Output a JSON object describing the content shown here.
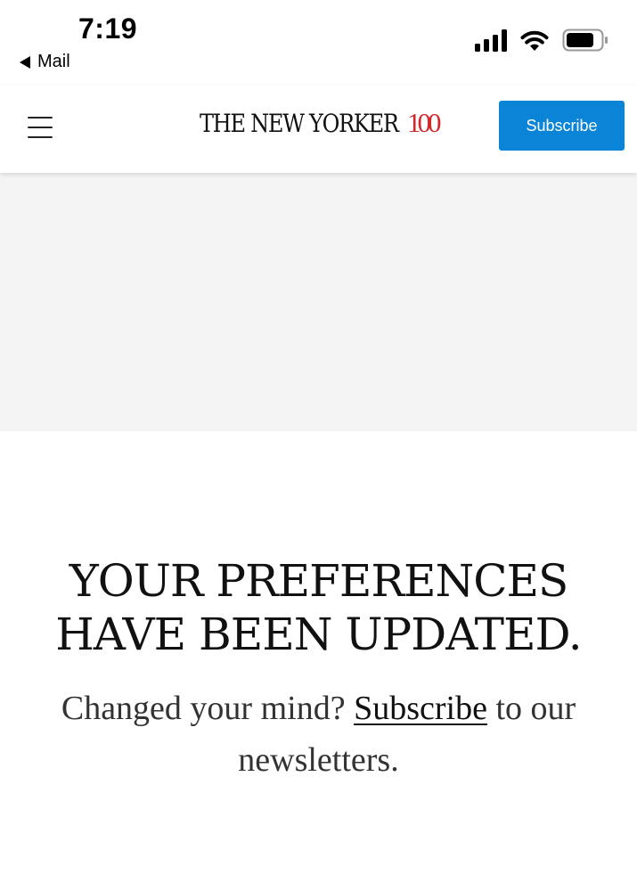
{
  "status_bar": {
    "time": "7:19",
    "back_app": "Mail",
    "icons": [
      "cellular-signal-icon",
      "wifi-icon",
      "battery-icon"
    ]
  },
  "header": {
    "logo_text": "THE NEW YORKER",
    "logo_accent": "100",
    "menu_icon": "hamburger-menu-icon",
    "subscribe_label": "Subscribe"
  },
  "message": {
    "headline_line1": "YOUR PREFERENCES",
    "headline_line2": "HAVE BEEN UPDATED.",
    "prefix": "Changed your mind?",
    "link_label": "Subscribe",
    "suffix": "to our newsletters."
  },
  "colors": {
    "subscribe_button_bg": "#0a84d6",
    "logo_accent": "#d0282d",
    "ad_placeholder_bg": "#f4f4f4"
  }
}
